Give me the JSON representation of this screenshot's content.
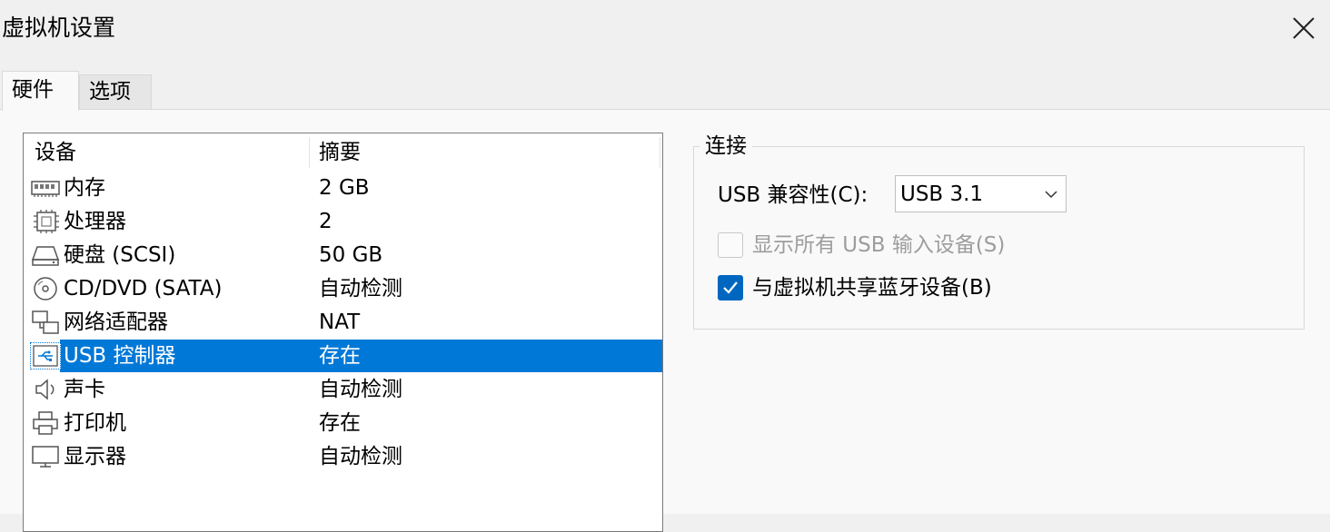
{
  "window": {
    "title": "虚拟机设置",
    "close_icon": "close-icon"
  },
  "tabs": [
    {
      "label": "硬件",
      "active": true
    },
    {
      "label": "选项",
      "active": false
    }
  ],
  "device_list": {
    "columns": [
      "设备",
      "摘要"
    ],
    "rows": [
      {
        "name": "内存",
        "summary": "2 GB",
        "icon": "memory-icon"
      },
      {
        "name": "处理器",
        "summary": "2",
        "icon": "processor-icon"
      },
      {
        "name": "硬盘 (SCSI)",
        "summary": "50 GB",
        "icon": "hard-disk-icon"
      },
      {
        "name": "CD/DVD (SATA)",
        "summary": "自动检测",
        "icon": "cd-dvd-icon"
      },
      {
        "name": "网络适配器",
        "summary": "NAT",
        "icon": "network-adapter-icon"
      },
      {
        "name": "USB 控制器",
        "summary": "存在",
        "icon": "usb-icon",
        "selected": true
      },
      {
        "name": "声卡",
        "summary": "自动检测",
        "icon": "speaker-icon"
      },
      {
        "name": "打印机",
        "summary": "存在",
        "icon": "printer-icon"
      },
      {
        "name": "显示器",
        "summary": "自动检测",
        "icon": "monitor-icon"
      }
    ]
  },
  "connection": {
    "group_title": "连接",
    "compat_label": "USB 兼容性(C):",
    "compat_value": "USB 3.1",
    "show_all_label": "显示所有 USB 输入设备(S)",
    "show_all_checked": false,
    "show_all_enabled": false,
    "share_bt_label": "与虚拟机共享蓝牙设备(B)",
    "share_bt_checked": true
  },
  "colors": {
    "selection": "#0078d7",
    "checkbox_checked": "#0067c0"
  }
}
